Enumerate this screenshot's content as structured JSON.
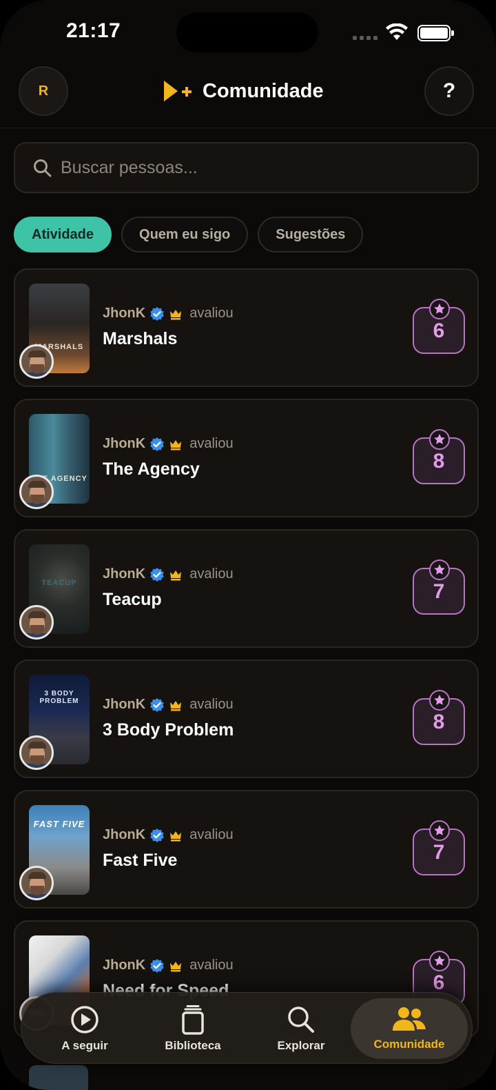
{
  "status_bar": {
    "time": "21:17"
  },
  "header": {
    "avatar_initial": "R",
    "title": "Comunidade",
    "help_label": "?"
  },
  "search": {
    "placeholder": "Buscar pessoas..."
  },
  "tabs": [
    {
      "label": "Atividade",
      "active": true
    },
    {
      "label": "Quem eu sigo",
      "active": false
    },
    {
      "label": "Sugestões",
      "active": false
    }
  ],
  "feed": [
    {
      "user": "JhonK",
      "action": "avaliou",
      "title": "Marshals",
      "rating": "6",
      "poster_text": "MARSHALS"
    },
    {
      "user": "JhonK",
      "action": "avaliou",
      "title": "The Agency",
      "rating": "8",
      "poster_text": "THE AGENCY"
    },
    {
      "user": "JhonK",
      "action": "avaliou",
      "title": "Teacup",
      "rating": "7",
      "poster_text": "TEACUP"
    },
    {
      "user": "JhonK",
      "action": "avaliou",
      "title": "3 Body Problem",
      "rating": "8",
      "poster_text": "3 BODY PROBLEM"
    },
    {
      "user": "JhonK",
      "action": "avaliou",
      "title": "Fast Five",
      "rating": "7",
      "poster_text": "FAST FIVE"
    },
    {
      "user": "JhonK",
      "action": "avaliou",
      "title": "Need for Speed",
      "rating": "6",
      "poster_text": ""
    }
  ],
  "bottom_nav": [
    {
      "label": "A seguir",
      "icon": "play-circle-icon",
      "active": false
    },
    {
      "label": "Biblioteca",
      "icon": "library-icon",
      "active": false
    },
    {
      "label": "Explorar",
      "icon": "search-icon",
      "active": false
    },
    {
      "label": "Comunidade",
      "icon": "people-icon",
      "active": true
    }
  ],
  "colors": {
    "accent": "#f2b51c",
    "tab_active": "#3fc3a6",
    "rating": "#e39ce8",
    "verified": "#3b8fe8"
  }
}
